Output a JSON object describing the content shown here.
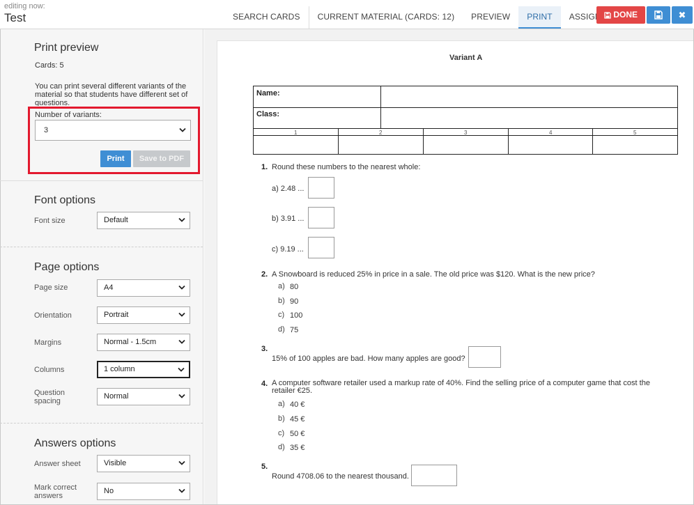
{
  "header": {
    "editing_label": "editing now:",
    "doc_title": "Test",
    "tabs": [
      "SEARCH CARDS",
      "CURRENT MATERIAL (CARDS: 12)",
      "PREVIEW",
      "PRINT",
      "ASSIGN"
    ],
    "active_tab": "PRINT",
    "done_label": "DONE",
    "close_glyph": "✖",
    "colors": {
      "done": "#e34646",
      "primary": "#3f8ed4"
    },
    "icons": [
      "save-icon",
      "close-icon"
    ]
  },
  "print_preview": {
    "title": "Print preview",
    "cards": "Cards: 5",
    "description": "You can print several different variants of the material so that students have different set of questions.",
    "variants_label": "Number of variants:",
    "variants_value": "3",
    "print_label": "Print",
    "pdf_label": "Save to PDF"
  },
  "font_options": {
    "title": "Font options",
    "font_size_label": "Font size",
    "font_size_value": "Default"
  },
  "page_options": {
    "title": "Page options",
    "page_size_label": "Page size",
    "page_size_value": "A4",
    "orientation_label": "Orientation",
    "orientation_value": "Portrait",
    "margins_label": "Margins",
    "margins_value": "Normal - 1.5cm",
    "columns_label": "Columns",
    "columns_value": "1 column",
    "spacing_label": "Question spacing",
    "spacing_value": "Normal"
  },
  "answers_options": {
    "title": "Answers options",
    "sheet_label": "Answer sheet",
    "sheet_value": "Visible",
    "mark_label": "Mark correct answers",
    "mark_value": "No"
  },
  "preview": {
    "variant_title": "Variant A",
    "name_label": "Name:",
    "class_label": "Class:",
    "columns": [
      "1",
      "2",
      "3",
      "4",
      "5"
    ],
    "q1": {
      "number": "1.",
      "text": "Round these numbers to the nearest whole:",
      "parts": [
        "a) 2.48 ...",
        "b) 3.91 ...",
        "c) 9.19 ..."
      ]
    },
    "q2": {
      "number": "2.",
      "text": "A Snowboard is reduced 25% in price in a sale. The old price was $120. What is the new price?",
      "letters": [
        "a)",
        "b)",
        "c)",
        "d)"
      ],
      "values": [
        "80",
        "90",
        "100",
        "75"
      ]
    },
    "q3": {
      "number": "3.",
      "text": "15% of 100 apples are bad. How many apples are good?"
    },
    "q4": {
      "number": "4.",
      "text": "A computer software retailer used a markup rate of 40%. Find the selling price of a computer game that cost the retailer €25.",
      "letters": [
        "a)",
        "b)",
        "c)",
        "d)"
      ],
      "values": [
        "40 €",
        "45 €",
        "50 €",
        "35 €"
      ]
    },
    "q5": {
      "number": "5.",
      "text": "Round 4708.06 to the nearest thousand."
    }
  }
}
